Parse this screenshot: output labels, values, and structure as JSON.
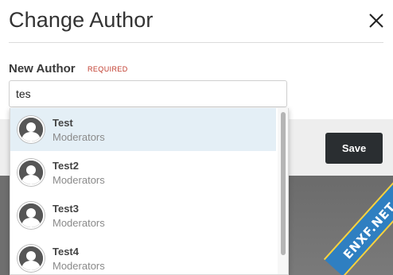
{
  "modal": {
    "title": "Change Author",
    "close_icon": "close-icon"
  },
  "field": {
    "label": "New Author",
    "required": "REQUIRED",
    "value": "tes"
  },
  "footer": {
    "save_label": "Save"
  },
  "suggestions": [
    {
      "name": "Test",
      "group": "Moderators",
      "highlighted": true
    },
    {
      "name": "Test2",
      "group": "Moderators",
      "highlighted": false
    },
    {
      "name": "Test3",
      "group": "Moderators",
      "highlighted": false
    },
    {
      "name": "Test4",
      "group": "Moderators",
      "highlighted": false
    }
  ],
  "watermark": {
    "text": "ENXF.NET"
  },
  "colors": {
    "accent_dark": "#2a2e31",
    "required": "#c0392b",
    "highlight": "#e4eff6"
  }
}
